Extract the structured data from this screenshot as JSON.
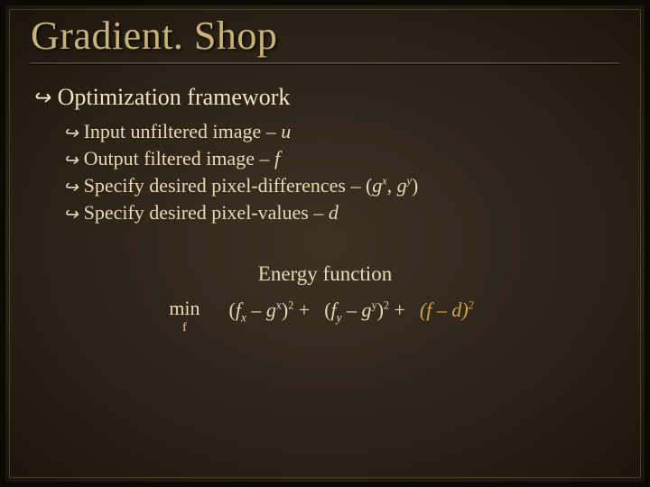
{
  "title": "Gradient. Shop",
  "section_heading": "Optimization framework",
  "bullets": [
    {
      "text_before": "Input unfiltered image – ",
      "var": "u",
      "text_after": ""
    },
    {
      "text_before": "Output filtered image – ",
      "var": "f",
      "text_after": ""
    },
    {
      "text_before": "Specify desired pixel-differences – (",
      "var1": "g",
      "sup1": "x",
      "mid": ", ",
      "var2": "g",
      "sup2": "y",
      "text_after": ")"
    },
    {
      "text_before": "Specify desired pixel-values – ",
      "var": "d",
      "text_after": ""
    }
  ],
  "bullet_marker": "↪",
  "sub_marker": "↪",
  "energy": {
    "caption": "Energy function",
    "min_label": "min",
    "min_subscript": "f",
    "term1": {
      "open": "(",
      "f": "f",
      "fsub": "x",
      "minus": " – ",
      "g": "g",
      "gsup": "x",
      "close": ")",
      "exp": "2",
      "plus": " +"
    },
    "term2": {
      "open": "(",
      "f": "f",
      "fsub": "y",
      "minus": " – ",
      "g": "g",
      "gsup": "y",
      "close": ")",
      "exp": "2",
      "plus": " +"
    },
    "term3": {
      "open": "(",
      "f": "f",
      "minus": " – ",
      "d": "d",
      "close": ")",
      "exp": "2"
    }
  }
}
